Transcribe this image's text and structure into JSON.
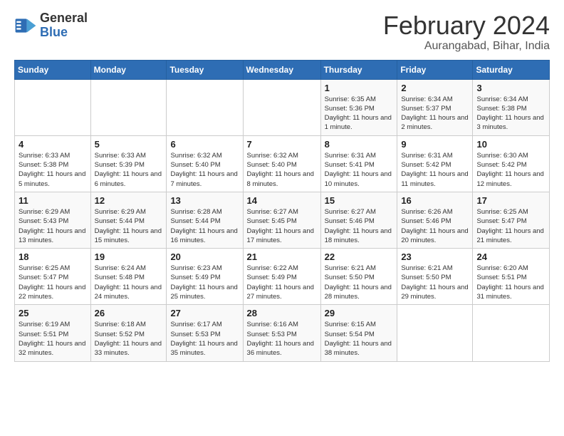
{
  "logo": {
    "general": "General",
    "blue": "Blue"
  },
  "title": {
    "month_year": "February 2024",
    "location": "Aurangabad, Bihar, India"
  },
  "days_of_week": [
    "Sunday",
    "Monday",
    "Tuesday",
    "Wednesday",
    "Thursday",
    "Friday",
    "Saturday"
  ],
  "weeks": [
    [
      {
        "day": "",
        "info": ""
      },
      {
        "day": "",
        "info": ""
      },
      {
        "day": "",
        "info": ""
      },
      {
        "day": "",
        "info": ""
      },
      {
        "day": "1",
        "info": "Sunrise: 6:35 AM\nSunset: 5:36 PM\nDaylight: 11 hours and 1 minute."
      },
      {
        "day": "2",
        "info": "Sunrise: 6:34 AM\nSunset: 5:37 PM\nDaylight: 11 hours and 2 minutes."
      },
      {
        "day": "3",
        "info": "Sunrise: 6:34 AM\nSunset: 5:38 PM\nDaylight: 11 hours and 3 minutes."
      }
    ],
    [
      {
        "day": "4",
        "info": "Sunrise: 6:33 AM\nSunset: 5:38 PM\nDaylight: 11 hours and 5 minutes."
      },
      {
        "day": "5",
        "info": "Sunrise: 6:33 AM\nSunset: 5:39 PM\nDaylight: 11 hours and 6 minutes."
      },
      {
        "day": "6",
        "info": "Sunrise: 6:32 AM\nSunset: 5:40 PM\nDaylight: 11 hours and 7 minutes."
      },
      {
        "day": "7",
        "info": "Sunrise: 6:32 AM\nSunset: 5:40 PM\nDaylight: 11 hours and 8 minutes."
      },
      {
        "day": "8",
        "info": "Sunrise: 6:31 AM\nSunset: 5:41 PM\nDaylight: 11 hours and 10 minutes."
      },
      {
        "day": "9",
        "info": "Sunrise: 6:31 AM\nSunset: 5:42 PM\nDaylight: 11 hours and 11 minutes."
      },
      {
        "day": "10",
        "info": "Sunrise: 6:30 AM\nSunset: 5:42 PM\nDaylight: 11 hours and 12 minutes."
      }
    ],
    [
      {
        "day": "11",
        "info": "Sunrise: 6:29 AM\nSunset: 5:43 PM\nDaylight: 11 hours and 13 minutes."
      },
      {
        "day": "12",
        "info": "Sunrise: 6:29 AM\nSunset: 5:44 PM\nDaylight: 11 hours and 15 minutes."
      },
      {
        "day": "13",
        "info": "Sunrise: 6:28 AM\nSunset: 5:44 PM\nDaylight: 11 hours and 16 minutes."
      },
      {
        "day": "14",
        "info": "Sunrise: 6:27 AM\nSunset: 5:45 PM\nDaylight: 11 hours and 17 minutes."
      },
      {
        "day": "15",
        "info": "Sunrise: 6:27 AM\nSunset: 5:46 PM\nDaylight: 11 hours and 18 minutes."
      },
      {
        "day": "16",
        "info": "Sunrise: 6:26 AM\nSunset: 5:46 PM\nDaylight: 11 hours and 20 minutes."
      },
      {
        "day": "17",
        "info": "Sunrise: 6:25 AM\nSunset: 5:47 PM\nDaylight: 11 hours and 21 minutes."
      }
    ],
    [
      {
        "day": "18",
        "info": "Sunrise: 6:25 AM\nSunset: 5:47 PM\nDaylight: 11 hours and 22 minutes."
      },
      {
        "day": "19",
        "info": "Sunrise: 6:24 AM\nSunset: 5:48 PM\nDaylight: 11 hours and 24 minutes."
      },
      {
        "day": "20",
        "info": "Sunrise: 6:23 AM\nSunset: 5:49 PM\nDaylight: 11 hours and 25 minutes."
      },
      {
        "day": "21",
        "info": "Sunrise: 6:22 AM\nSunset: 5:49 PM\nDaylight: 11 hours and 27 minutes."
      },
      {
        "day": "22",
        "info": "Sunrise: 6:21 AM\nSunset: 5:50 PM\nDaylight: 11 hours and 28 minutes."
      },
      {
        "day": "23",
        "info": "Sunrise: 6:21 AM\nSunset: 5:50 PM\nDaylight: 11 hours and 29 minutes."
      },
      {
        "day": "24",
        "info": "Sunrise: 6:20 AM\nSunset: 5:51 PM\nDaylight: 11 hours and 31 minutes."
      }
    ],
    [
      {
        "day": "25",
        "info": "Sunrise: 6:19 AM\nSunset: 5:51 PM\nDaylight: 11 hours and 32 minutes."
      },
      {
        "day": "26",
        "info": "Sunrise: 6:18 AM\nSunset: 5:52 PM\nDaylight: 11 hours and 33 minutes."
      },
      {
        "day": "27",
        "info": "Sunrise: 6:17 AM\nSunset: 5:53 PM\nDaylight: 11 hours and 35 minutes."
      },
      {
        "day": "28",
        "info": "Sunrise: 6:16 AM\nSunset: 5:53 PM\nDaylight: 11 hours and 36 minutes."
      },
      {
        "day": "29",
        "info": "Sunrise: 6:15 AM\nSunset: 5:54 PM\nDaylight: 11 hours and 38 minutes."
      },
      {
        "day": "",
        "info": ""
      },
      {
        "day": "",
        "info": ""
      }
    ]
  ]
}
